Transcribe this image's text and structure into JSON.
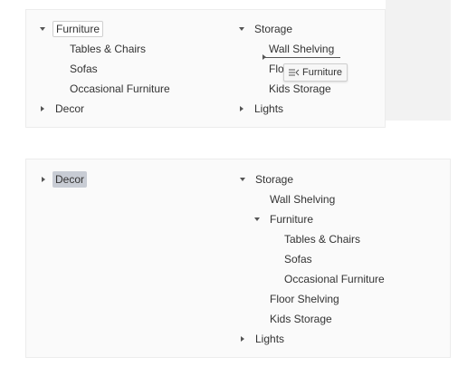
{
  "top": {
    "left_tree": {
      "furniture": "Furniture",
      "children": [
        "Tables & Chairs",
        "Sofas",
        "Occasional Furniture"
      ],
      "decor": "Decor"
    },
    "right_tree": {
      "storage": "Storage",
      "wall_shelving": "Wall Shelving",
      "floor_partial": "Flo",
      "kids_storage": "Kids Storage",
      "lights": "Lights"
    },
    "drag_tooltip": {
      "icon": "insert-icon",
      "label": "Furniture"
    }
  },
  "bottom": {
    "left_tree": {
      "decor": "Decor"
    },
    "right_tree": {
      "storage": "Storage",
      "wall_shelving": "Wall Shelving",
      "furniture": "Furniture",
      "furniture_children": [
        "Tables & Chairs",
        "Sofas",
        "Occasional Furniture"
      ],
      "floor_shelving": "Floor Shelving",
      "kids_storage": "Kids Storage",
      "lights": "Lights"
    }
  },
  "colors": {
    "selected_fill": "#c8ccd4",
    "selected_outline": "#cfcfcf",
    "panel_bg": "#fafafa"
  }
}
